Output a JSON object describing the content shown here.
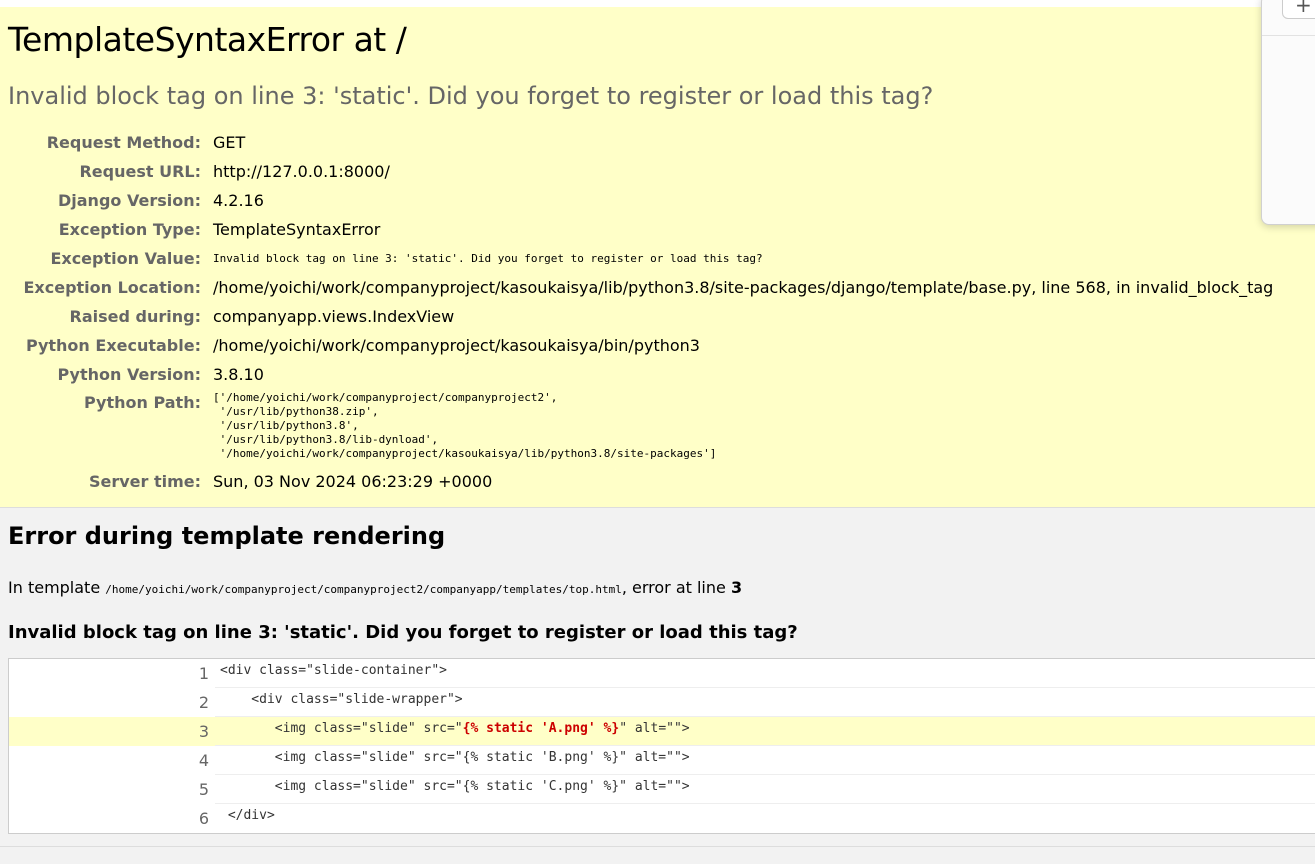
{
  "summary": {
    "title": "TemplateSyntaxError at /",
    "exception_message": "Invalid block tag on line 3: 'static'. Did you forget to register or load this tag?",
    "meta": {
      "request_method_label": "Request Method:",
      "request_method": "GET",
      "request_url_label": "Request URL:",
      "request_url": "http://127.0.0.1:8000/",
      "django_version_label": "Django Version:",
      "django_version": "4.2.16",
      "exception_type_label": "Exception Type:",
      "exception_type": "TemplateSyntaxError",
      "exception_value_label": "Exception Value:",
      "exception_value": "Invalid block tag on line 3: 'static'. Did you forget to register or load this tag?",
      "exception_location_label": "Exception Location:",
      "exception_location": "/home/yoichi/work/companyproject/kasoukaisya/lib/python3.8/site-packages/django/template/base.py, line 568, in invalid_block_tag",
      "raised_during_label": "Raised during:",
      "raised_during": "companyapp.views.IndexView",
      "python_executable_label": "Python Executable:",
      "python_executable": "/home/yoichi/work/companyproject/kasoukaisya/bin/python3",
      "python_version_label": "Python Version:",
      "python_version": "3.8.10",
      "python_path_label": "Python Path:",
      "python_path": [
        "['/home/yoichi/work/companyproject/companyproject2',",
        " '/usr/lib/python38.zip',",
        " '/usr/lib/python3.8',",
        " '/usr/lib/python3.8/lib-dynload',",
        " '/home/yoichi/work/companyproject/kasoukaisya/lib/python3.8/site-packages']"
      ],
      "server_time_label": "Server time:",
      "server_time": "Sun, 03 Nov 2024 06:23:29 +0000"
    }
  },
  "template": {
    "heading": "Error during template rendering",
    "in_template_prefix": "In template ",
    "template_path": "/home/yoichi/work/companyproject/companyproject2/companyapp/templates/top.html",
    "error_at_line_text": ", error at line ",
    "error_line": "3",
    "message": "Invalid block tag on line 3: 'static'. Did you forget to register or load this tag?",
    "lines": [
      {
        "num": "1",
        "code": "<div class=\"slide-container\">"
      },
      {
        "num": "2",
        "code": "    <div class=\"slide-wrapper\">"
      },
      {
        "num": "3",
        "code_before": "       <img class=\"slide\" src=\"",
        "code_error": "{% static 'A.png' %}",
        "code_after": "\" alt=\"\">"
      },
      {
        "num": "4",
        "code": "       <img class=\"slide\" src=\"{% static 'B.png' %}\" alt=\"\">"
      },
      {
        "num": "5",
        "code": "       <img class=\"slide\" src=\"{% static 'C.png' %}\" alt=\"\">"
      },
      {
        "num": "6",
        "code": " </div>"
      }
    ]
  },
  "popup": {
    "plus_symbol": "+"
  },
  "colors": {
    "summary_bg": "#ffffc8",
    "error_highlight": "#cc0000",
    "label_gray": "#666666"
  }
}
